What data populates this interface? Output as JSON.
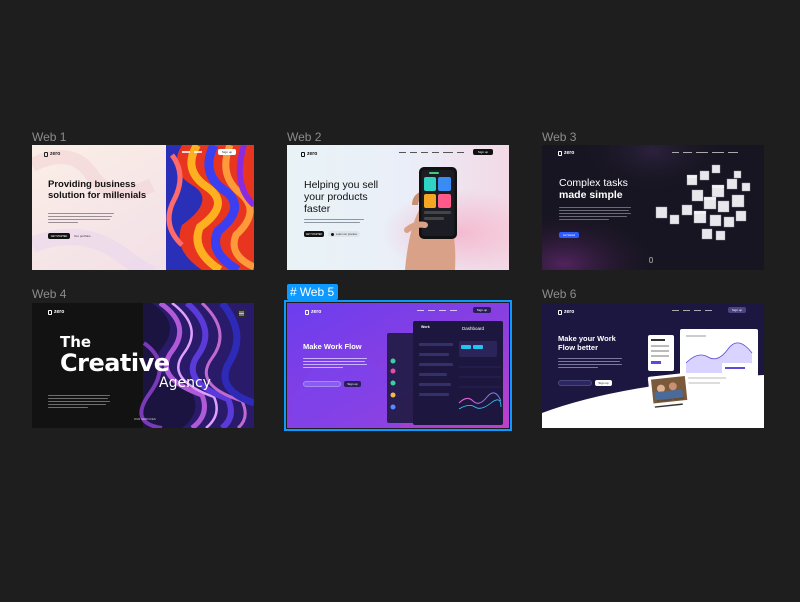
{
  "canvas": {
    "background": "#1e1e1e",
    "selection_color": "#0d99ff",
    "grid_icon": "hash-icon"
  },
  "frames": [
    {
      "label": "Web 1",
      "logo": "zero",
      "headline": "Providing business solution for millenials",
      "cta": "GET STARTED",
      "secondary": "Our portfolio",
      "nav_button": "Sign up"
    },
    {
      "label": "Web 2",
      "logo": "zero",
      "headline": "Helping you sell your products faster",
      "cta": "GET STARTED",
      "secondary": "Learn our process",
      "nav_button": "Sign up"
    },
    {
      "label": "Web 3",
      "logo": "zero",
      "headline_line1": "Complex tasks",
      "headline_line2": "made simple",
      "cta": "Get Started"
    },
    {
      "label": "Web 4",
      "logo": "zero",
      "headline_line1": "The",
      "headline_line2": "Creative",
      "headline_line3": "Agency",
      "footer_link": "OUR SERVICES"
    },
    {
      "label": "Web 5",
      "logo": "zero",
      "headline": "Make Work Flow",
      "cta": "Sign up",
      "nav_button": "Sign up",
      "panel_title": "Dashboard",
      "panel_left_title": "Work"
    },
    {
      "label": "Web 6",
      "logo": "zero",
      "headline": "Make your Work Flow better",
      "cta": "Sign up",
      "nav_button": "Sign up",
      "card_caption": "20 Employees Completed"
    }
  ]
}
